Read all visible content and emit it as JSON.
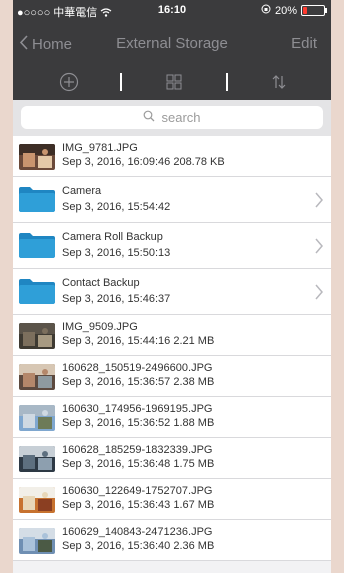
{
  "status": {
    "carrier": "●○○○○ 中華電信",
    "time": "16:10",
    "battery": "20%",
    "battery_level": 0.2,
    "battery_color": "#ff3b30"
  },
  "nav": {
    "back_label": "Home",
    "title": "External Storage",
    "edit_label": "Edit"
  },
  "toolbar": {
    "icons": [
      "add-circle-icon",
      "grid-view-icon",
      "sort-icon"
    ]
  },
  "search": {
    "placeholder": "search"
  },
  "files": [
    {
      "type": "image",
      "name": "IMG_9781.JPG",
      "date": "Sep 3, 2016, 16:09:46",
      "size": "208.78 KB"
    },
    {
      "type": "folder",
      "name": "Camera",
      "date": "Sep 3, 2016, 15:54:42",
      "size": ""
    },
    {
      "type": "folder",
      "name": "Camera Roll Backup",
      "date": "Sep 3, 2016, 15:50:13",
      "size": ""
    },
    {
      "type": "folder",
      "name": "Contact Backup",
      "date": "Sep 3, 2016, 15:46:37",
      "size": ""
    },
    {
      "type": "image",
      "name": "IMG_9509.JPG",
      "date": "Sep 3, 2016, 15:44:16",
      "size": "2.21 MB"
    },
    {
      "type": "image",
      "name": "160628_150519-2496600.JPG",
      "date": "Sep 3, 2016, 15:36:57",
      "size": "2.38 MB"
    },
    {
      "type": "image",
      "name": "160630_174956-1969195.JPG",
      "date": "Sep 3, 2016, 15:36:52",
      "size": "1.88 MB"
    },
    {
      "type": "image",
      "name": "160628_185259-1832339.JPG",
      "date": "Sep 3, 2016, 15:36:48",
      "size": "1.75 MB"
    },
    {
      "type": "image",
      "name": "160630_122649-1752707.JPG",
      "date": "Sep 3, 2016, 15:36:43",
      "size": "1.67 MB"
    },
    {
      "type": "image",
      "name": "160629_140843-2471236.JPG",
      "date": "Sep 3, 2016, 15:36:40",
      "size": "2.36 MB"
    }
  ],
  "colors": {
    "bar_bg": "#3b3b3d",
    "folder": "#2f9fd8",
    "folder_tab": "#1f86c2"
  }
}
